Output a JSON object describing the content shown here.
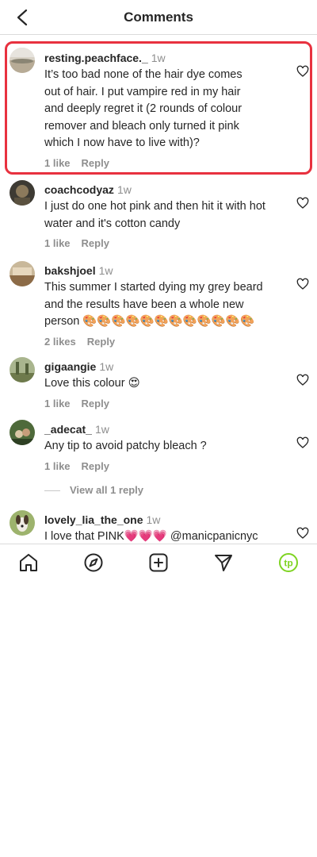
{
  "header": {
    "title": "Comments",
    "back_icon": "chevron-left-icon"
  },
  "comments": [
    {
      "username": "resting.peachface._",
      "time": "1w",
      "text": "It’s too bad none of the hair dye comes out of hair. I put vampire red in my hair and deeply regret it (2 rounds of colour remover and bleach only turned it pink which I now have to live with)?",
      "likes": "1 like",
      "reply": "Reply",
      "highlighted": true
    },
    {
      "username": "coachcodyaz",
      "time": "1w",
      "text": "I just do one hot pink and then hit it with hot water and it's cotton candy",
      "likes": "1 like",
      "reply": "Reply"
    },
    {
      "username": "bakshjoel",
      "time": "1w",
      "text": "This summer I started dying my grey beard and the results have been a whole new person 🎨🎨🎨🎨🎨🎨🎨🎨🎨🎨🎨🎨",
      "likes": "2 likes",
      "reply": "Reply"
    },
    {
      "username": "gigaangie",
      "time": "1w",
      "text": "Love this colour 😍",
      "likes": "1 like",
      "reply": "Reply"
    },
    {
      "username": "_adecat_",
      "time": "1w",
      "text": "Any tip to avoid patchy bleach ?",
      "likes": "1 like",
      "reply": "Reply"
    },
    {
      "username": "lovely_lia_the_one",
      "time": "1w",
      "text": "I love that PINK💗💗💗 @manicpanicnyc",
      "likes": "",
      "reply": ""
    }
  ],
  "view_replies": "View all 1 reply",
  "tabbar": {
    "items": [
      "home-icon",
      "explore-compass-icon",
      "create-plus-icon",
      "direct-send-icon",
      "profile-avatar-icon"
    ],
    "profile_initials": "tp",
    "accent": "#7ed321"
  },
  "colors": {
    "highlight": "#e8313f",
    "secondary_text": "#8e8e8e"
  }
}
